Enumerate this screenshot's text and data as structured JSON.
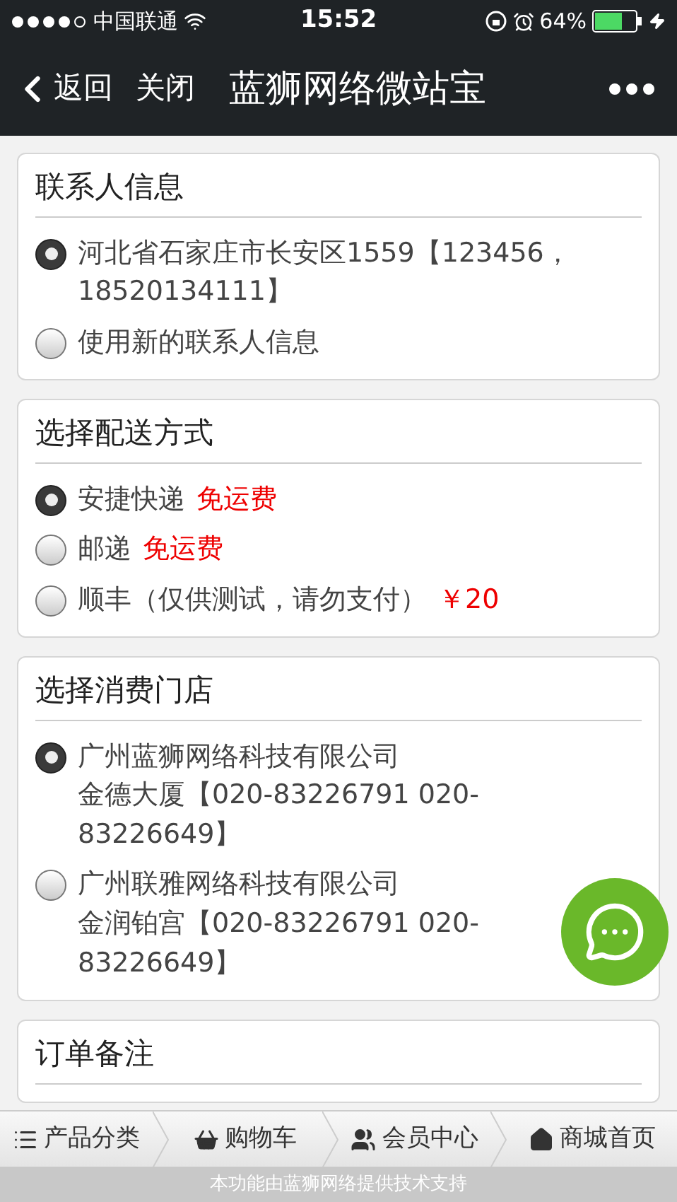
{
  "status_bar": {
    "carrier": "中国联通",
    "time": "15:52",
    "battery": "64%"
  },
  "nav": {
    "back": "返回",
    "close": "关闭",
    "title": "蓝狮网络微站宝"
  },
  "sections": [
    {
      "title": "联系人信息",
      "options": [
        {
          "lines": [
            "河北省石家庄市长安区1559【123456，18520134111】"
          ],
          "selected": true
        },
        {
          "lines": [
            "使用新的联系人信息"
          ],
          "selected": false
        }
      ]
    },
    {
      "title": "选择配送方式",
      "options": [
        {
          "lines": [
            "安捷快递"
          ],
          "note": "免运费",
          "selected": true
        },
        {
          "lines": [
            "邮递"
          ],
          "note": "免运费",
          "selected": false
        },
        {
          "lines": [
            "顺丰（仅供测试，请勿支付）"
          ],
          "note": "￥20",
          "selected": false
        }
      ]
    },
    {
      "title": "选择消费门店",
      "options": [
        {
          "lines": [
            "广州蓝狮网络科技有限公司",
            "金德大厦【020-83226791 020-83226649】"
          ],
          "selected": true
        },
        {
          "lines": [
            "广州联雅网络科技有限公司",
            "金润铂宫【020-83226791 020-83226649】"
          ],
          "selected": false
        }
      ]
    },
    {
      "title": "订单备注"
    }
  ],
  "bottom_nav": [
    {
      "label": "产品分类",
      "kind": "list"
    },
    {
      "label": "购物车",
      "kind": "basket"
    },
    {
      "label": "会员中心",
      "kind": "users"
    },
    {
      "label": "商城首页",
      "kind": "home"
    }
  ],
  "footer": "本功能由蓝狮网络提供技术支持"
}
